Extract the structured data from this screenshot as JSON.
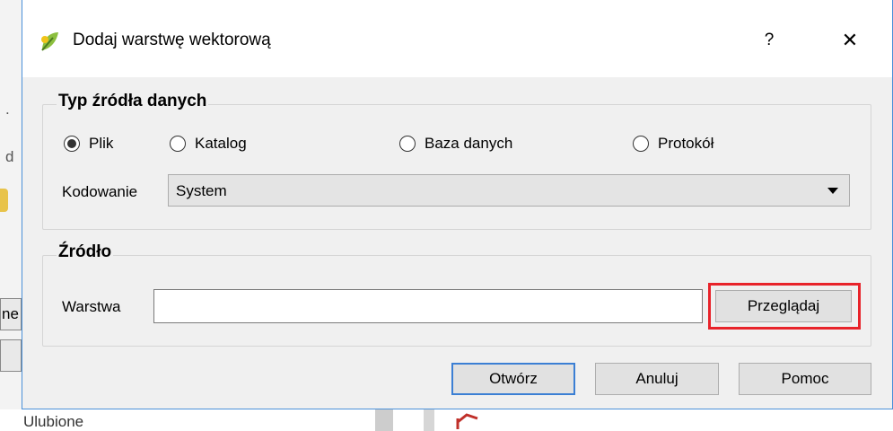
{
  "dialog": {
    "title": "Dodaj warstwę wektorową",
    "help_label": "?",
    "close_label": "✕"
  },
  "source_type": {
    "title": "Typ źródła danych",
    "options": [
      "Plik",
      "Katalog",
      "Baza danych",
      "Protokół"
    ],
    "selected": "Plik",
    "encoding_label": "Kodowanie",
    "encoding_value": "System"
  },
  "source": {
    "title": "Źródło",
    "layer_label": "Warstwa",
    "layer_value": "",
    "browse_label": "Przeglądaj"
  },
  "buttons": {
    "open": "Otwórz",
    "cancel": "Anuluj",
    "help": "Pomoc"
  },
  "background": {
    "fragments": [
      ".",
      "d",
      "ne",
      "Ulubione"
    ]
  },
  "colors": {
    "highlight": "#e8232a",
    "accent": "#3b7fd4"
  }
}
